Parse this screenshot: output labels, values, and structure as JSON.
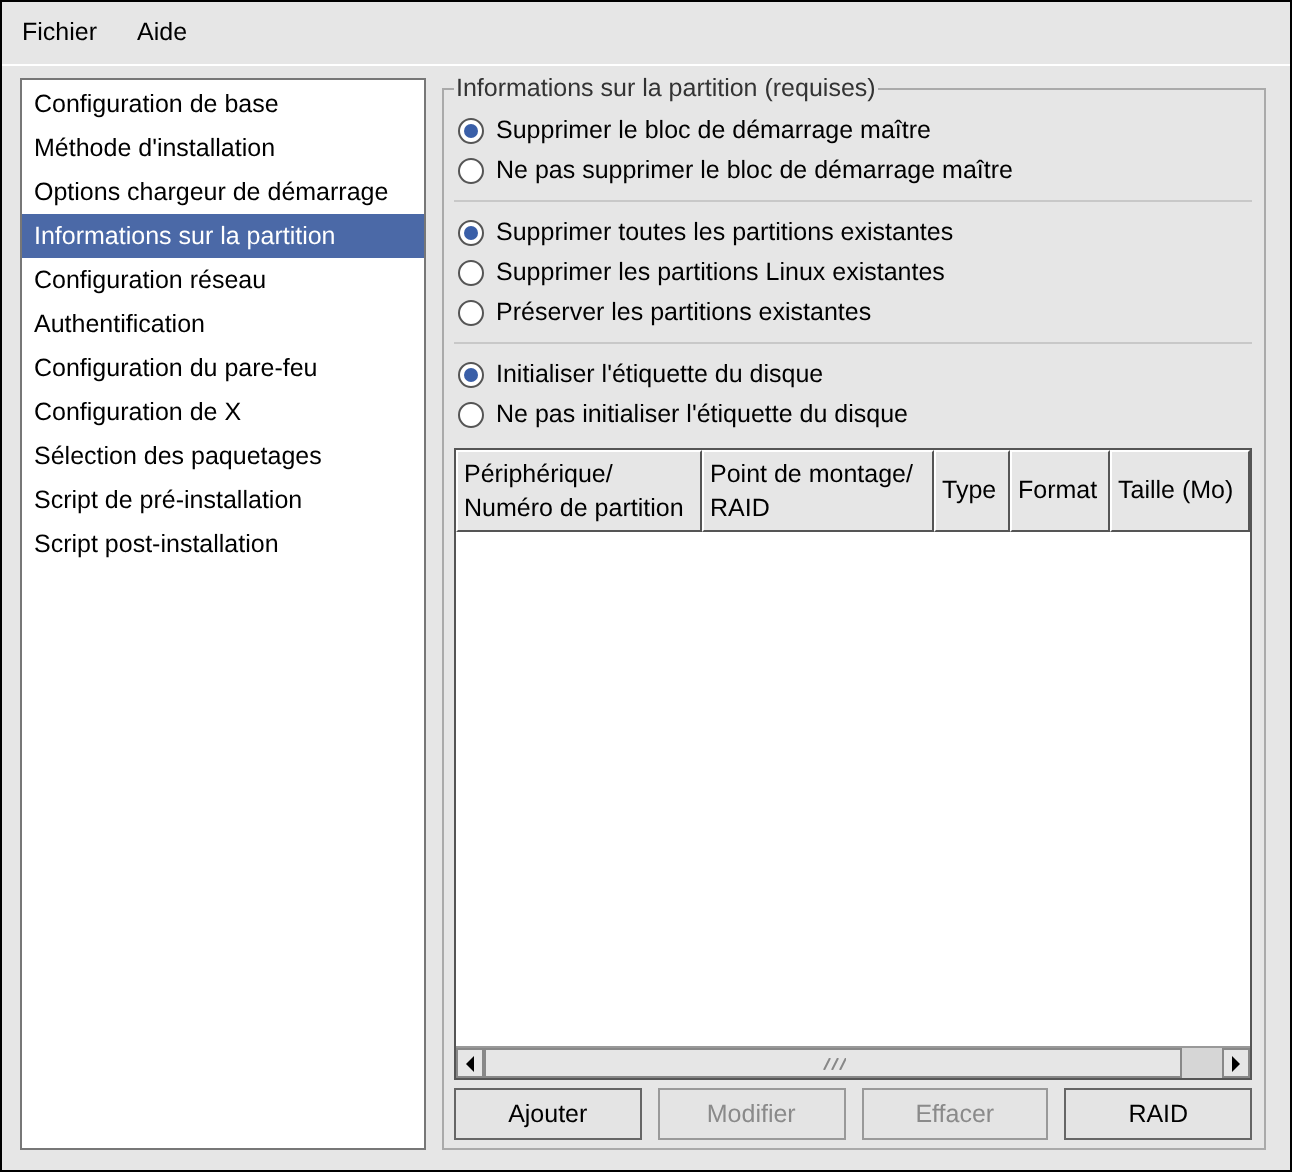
{
  "menu": [
    {
      "label": "Fichier"
    },
    {
      "label": "Aide"
    }
  ],
  "sidebar": {
    "items": [
      {
        "label": "Configuration de base",
        "selected": false
      },
      {
        "label": "Méthode d'installation",
        "selected": false
      },
      {
        "label": "Options chargeur de démarrage",
        "selected": false
      },
      {
        "label": "Informations sur la partition",
        "selected": true
      },
      {
        "label": "Configuration réseau",
        "selected": false
      },
      {
        "label": "Authentification",
        "selected": false
      },
      {
        "label": "Configuration du pare-feu",
        "selected": false
      },
      {
        "label": "Configuration de X",
        "selected": false
      },
      {
        "label": "Sélection des paquetages",
        "selected": false
      },
      {
        "label": "Script de pré-installation",
        "selected": false
      },
      {
        "label": "Script post-installation",
        "selected": false
      }
    ]
  },
  "panel": {
    "title": "Informations sur la partition (requises)",
    "radio_groups": [
      [
        {
          "label": "Supprimer le bloc de démarrage maître",
          "selected": true
        },
        {
          "label": "Ne pas supprimer le bloc de démarrage maître",
          "selected": false
        }
      ],
      [
        {
          "label": "Supprimer toutes les partitions existantes",
          "selected": true
        },
        {
          "label": "Supprimer les partitions Linux existantes",
          "selected": false
        },
        {
          "label": "Préserver les partitions existantes",
          "selected": false
        }
      ],
      [
        {
          "label": "Initialiser l'étiquette du disque",
          "selected": true
        },
        {
          "label": "Ne pas initialiser l'étiquette du disque",
          "selected": false
        }
      ]
    ],
    "table": {
      "columns": [
        "Périphérique/\nNuméro de partition",
        "Point de montage/\nRAID",
        "Type",
        "Format",
        "Taille (Mo)"
      ]
    },
    "buttons": [
      {
        "label": "Ajouter",
        "disabled": false
      },
      {
        "label": "Modifier",
        "disabled": true
      },
      {
        "label": "Effacer",
        "disabled": true
      },
      {
        "label": "RAID",
        "disabled": false
      }
    ]
  }
}
